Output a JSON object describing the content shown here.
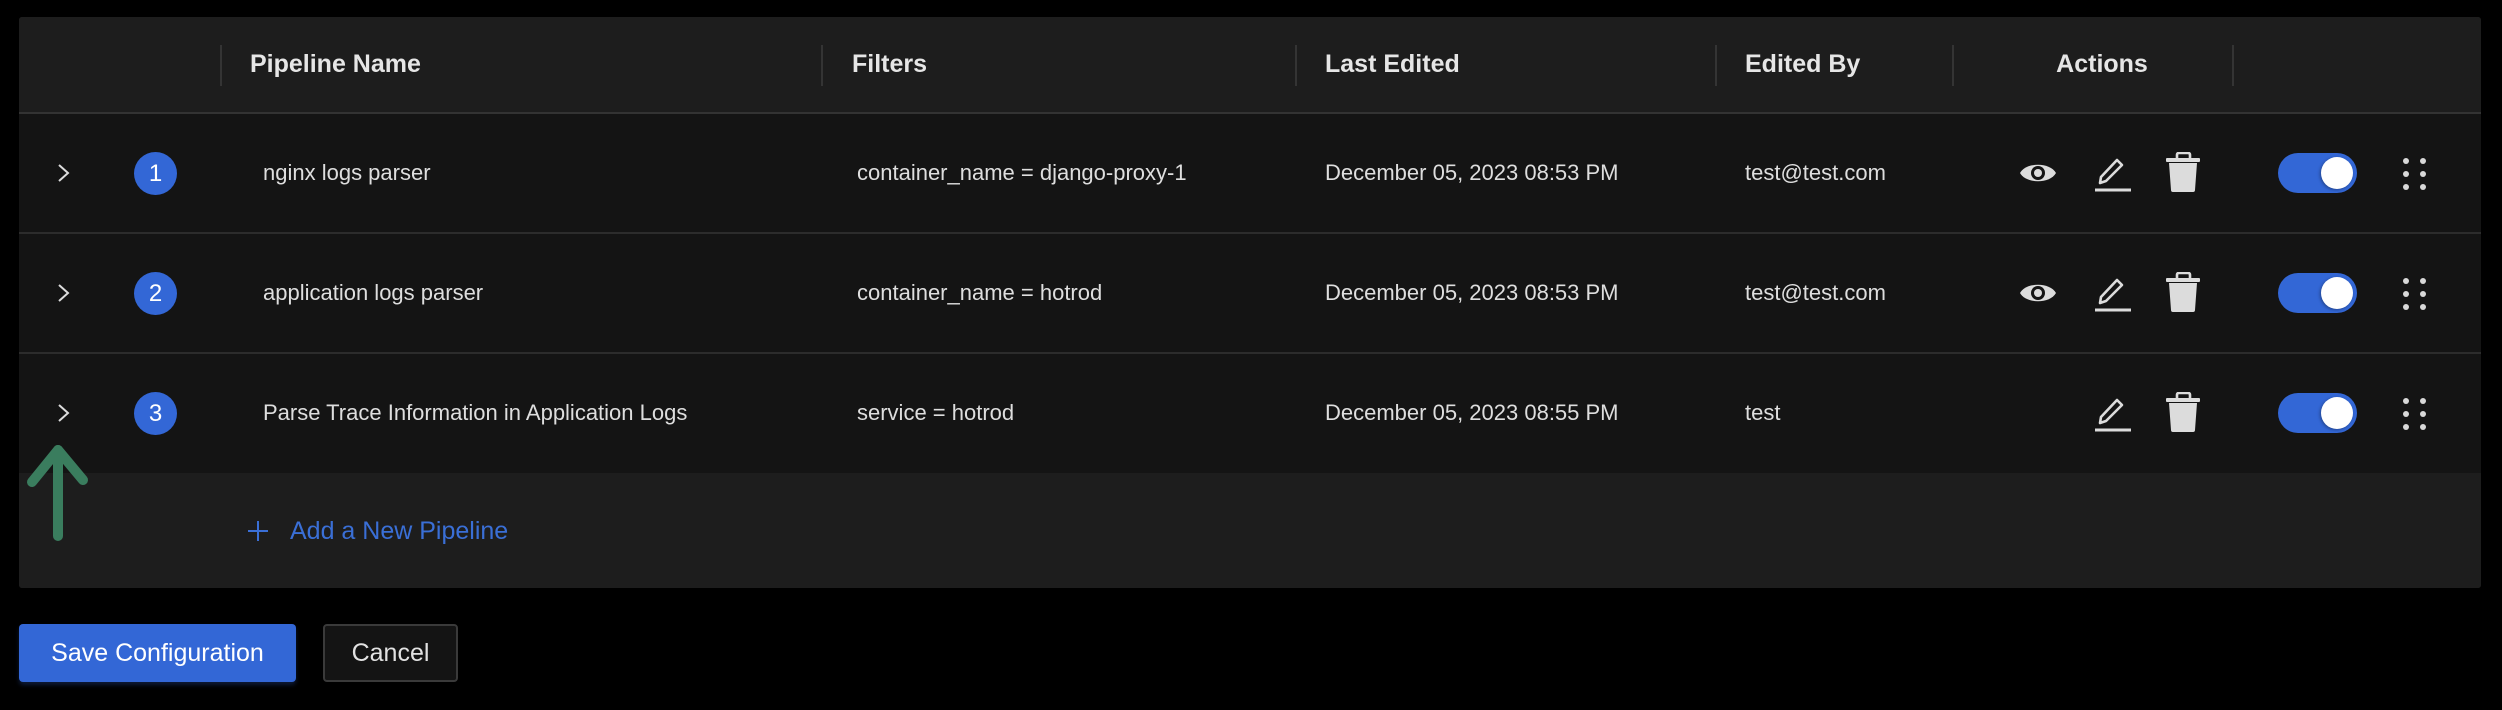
{
  "table": {
    "columns": {
      "pipeline_name": "Pipeline Name",
      "filters": "Filters",
      "last_edited": "Last Edited",
      "edited_by": "Edited By",
      "actions": "Actions"
    },
    "rows": [
      {
        "order": "1",
        "name": "nginx logs parser",
        "filter": "container_name = django-proxy-1",
        "last_edited": "December 05, 2023 08:53 PM",
        "edited_by": "test@test.com",
        "actions": [
          "eye-icon",
          "edit-icon",
          "delete-icon"
        ],
        "enabled": true
      },
      {
        "order": "2",
        "name": "application logs parser",
        "filter": "container_name = hotrod",
        "last_edited": "December 05, 2023 08:53 PM",
        "edited_by": "test@test.com",
        "actions": [
          "eye-icon",
          "edit-icon",
          "delete-icon"
        ],
        "enabled": true
      },
      {
        "order": "3",
        "name": "Parse Trace Information in Application Logs",
        "filter": "service = hotrod",
        "last_edited": "December 05, 2023 08:55 PM",
        "edited_by": "test",
        "actions": [
          "edit-icon",
          "delete-icon"
        ],
        "enabled": true
      }
    ],
    "add_pipeline_label": "Add a New Pipeline"
  },
  "footer": {
    "save_label": "Save Configuration",
    "cancel_label": "Cancel"
  },
  "colors": {
    "accent": "#3367d6",
    "annotation_arrow": "#3a7d5e",
    "link": "#3a6fd6"
  }
}
